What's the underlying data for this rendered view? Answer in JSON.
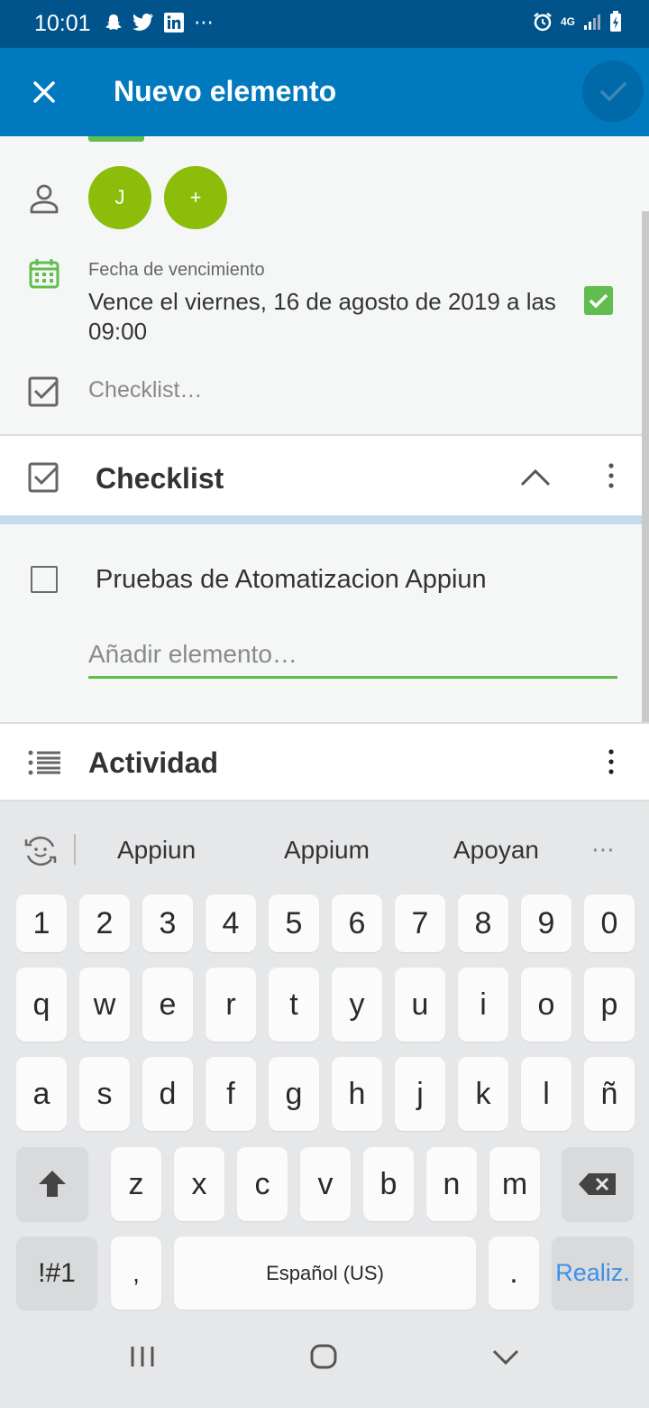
{
  "status_bar": {
    "time": "10:01",
    "network": "4G"
  },
  "app_bar": {
    "title": "Nuevo elemento"
  },
  "members": {
    "avatar_initial": "J",
    "add_label": "+"
  },
  "due_date": {
    "label": "Fecha de vencimiento",
    "value": "Vence el viernes, 16 de agosto de 2019 a las 09:00",
    "completed": true
  },
  "checklist_prompt": "Checklist…",
  "checklist_section": {
    "title": "Checklist",
    "items": [
      {
        "text": "Pruebas de Atomatizacion Appiun",
        "checked": false
      }
    ],
    "add_placeholder": "Añadir elemento…"
  },
  "activity_section": {
    "title": "Actividad"
  },
  "keyboard": {
    "suggestions": [
      "Appiun",
      "Appium",
      "Apoyan"
    ],
    "row_numbers": [
      "1",
      "2",
      "3",
      "4",
      "5",
      "6",
      "7",
      "8",
      "9",
      "0"
    ],
    "row_q": [
      "q",
      "w",
      "e",
      "r",
      "t",
      "y",
      "u",
      "i",
      "o",
      "p"
    ],
    "row_a": [
      "a",
      "s",
      "d",
      "f",
      "g",
      "h",
      "j",
      "k",
      "l",
      "ñ"
    ],
    "row_z": [
      "z",
      "x",
      "c",
      "v",
      "b",
      "n",
      "m"
    ],
    "symbols_label": "!#1",
    "comma_label": ",",
    "space_label": "Español (US)",
    "period_label": ".",
    "action_label": "Realiz."
  },
  "colors": {
    "primary": "#0079bf",
    "status_bar": "#00548b",
    "green": "#61bd4f",
    "avatar": "#8bbd0a",
    "action_text": "#3d8fe8"
  }
}
